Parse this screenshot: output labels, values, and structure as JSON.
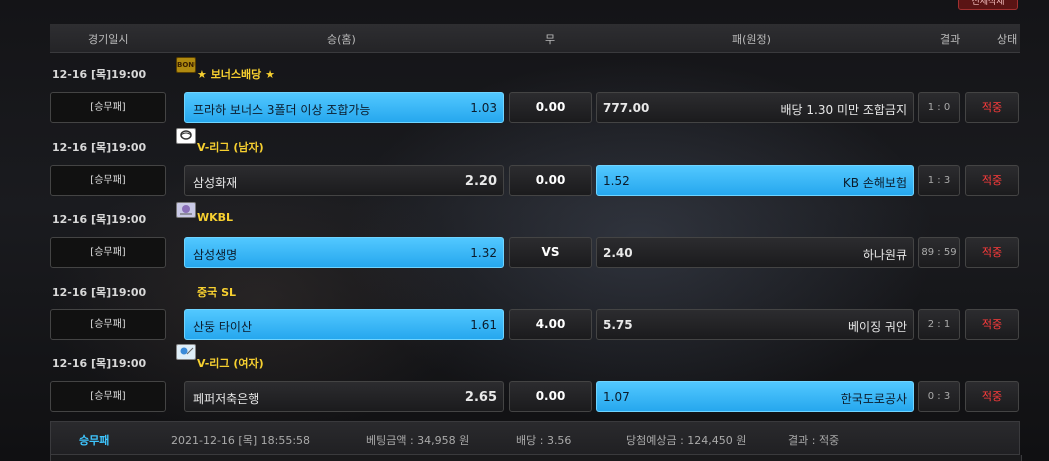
{
  "top_button": {
    "label": "전체삭제"
  },
  "header": {
    "date_time": "경기일시",
    "win_home": "승(홈)",
    "draw": "무",
    "lose_away": "패(원정)",
    "result": "결과",
    "status": "상태"
  },
  "games": [
    {
      "datetime": "12-16 [목]19:00",
      "league_icon": "bonus-icon",
      "league_icon_text": "BONUS",
      "league": "★ 보너스배당 ★",
      "type": "[승무패]",
      "home": "프라하 보너스 3폴더 이상 조합가능",
      "home_odd": "1.03",
      "draw": "0.00",
      "away_odd": "777.00",
      "away": "배당 1.30 미만 조합금지",
      "score": "1 : 0",
      "status": "적중",
      "selected": "home"
    },
    {
      "datetime": "12-16 [목]19:00",
      "league_icon": "volleyball-icon",
      "league": "V-리그 (남자)",
      "type": "[승무패]",
      "home": "삼성화재",
      "home_odd": "2.20",
      "draw": "0.00",
      "away_odd": "1.52",
      "away": "KB 손해보험",
      "score": "1 : 3",
      "status": "적중",
      "selected": "away"
    },
    {
      "datetime": "12-16 [목]19:00",
      "league_icon": "basketball-icon",
      "league": "WKBL",
      "type": "[승무패]",
      "home": "삼성생명",
      "home_odd": "1.32",
      "draw": "VS",
      "away_odd": "2.40",
      "away": "하나원큐",
      "score": "89 : 59",
      "status": "적중",
      "selected": "home"
    },
    {
      "datetime": "12-16 [목]19:00",
      "league_icon": "",
      "league": "중국 SL",
      "type": "[승무패]",
      "home": "산둥 타이산",
      "home_odd": "1.61",
      "draw": "4.00",
      "away_odd": "5.75",
      "away": "베이징 궈안",
      "score": "2 : 1",
      "status": "적중",
      "selected": "home"
    },
    {
      "datetime": "12-16 [목]19:00",
      "league_icon": "volleyball-icon",
      "league": "V-리그 (여자)",
      "type": "[승무패]",
      "home": "페퍼저축은행",
      "home_odd": "2.65",
      "draw": "0.00",
      "away_odd": "1.07",
      "away": "한국도로공사",
      "score": "0 : 3",
      "status": "적중",
      "selected": "away"
    }
  ],
  "summary": {
    "type": "승무패",
    "datetime": "2021-12-16 [목] 18:55:58",
    "bet_amount": "베팅금액 : 34,958 원",
    "odds": "배당 : 3.56",
    "expected_win": "당첨예상금 : 124,450 원",
    "result": "결과 : 적중"
  },
  "colors": {
    "selected": "#2fb2f5",
    "league": "#f7d030",
    "status_hit": "#ff3b3b",
    "summary_label": "#3ec6ff"
  }
}
